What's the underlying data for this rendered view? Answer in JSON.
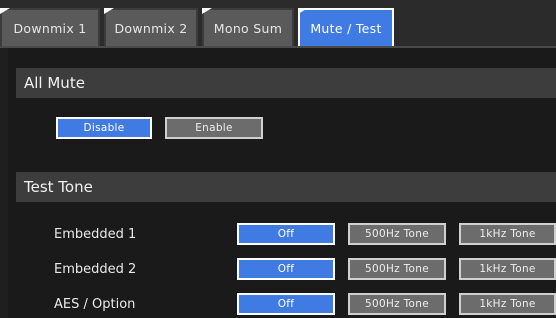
{
  "tabs": [
    {
      "label": "Downmix 1",
      "active": false
    },
    {
      "label": "Downmix 2",
      "active": false
    },
    {
      "label": "Mono Sum",
      "active": false
    },
    {
      "label": "Mute / Test",
      "active": true
    }
  ],
  "all_mute": {
    "title": "All Mute",
    "buttons": [
      {
        "label": "Disable",
        "selected": true
      },
      {
        "label": "Enable",
        "selected": false
      }
    ]
  },
  "test_tone": {
    "title": "Test Tone",
    "rows": [
      {
        "label": "Embedded 1",
        "options": [
          "Off",
          "500Hz Tone",
          "1kHz Tone"
        ],
        "selected": "Off"
      },
      {
        "label": "Embedded 2",
        "options": [
          "Off",
          "500Hz Tone",
          "1kHz Tone"
        ],
        "selected": "Off"
      },
      {
        "label": "AES / Option",
        "options": [
          "Off",
          "500Hz Tone",
          "1kHz Tone"
        ],
        "selected": "Off"
      }
    ]
  },
  "colors": {
    "accent": "#3f7be3",
    "button_inactive": "#6c6c6c",
    "section_header": "#3d3d3d",
    "background": "#1a1a1a"
  }
}
